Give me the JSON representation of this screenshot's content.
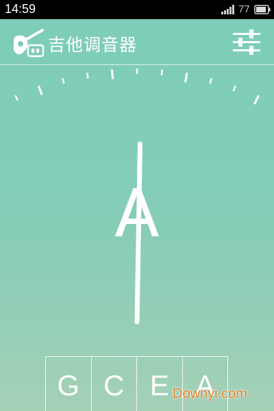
{
  "status_bar": {
    "time": "14:59",
    "battery_level": "77",
    "signal_icon": "signal-bars-icon",
    "battery_icon": "battery-icon"
  },
  "app_bar": {
    "title": "吉他调音器",
    "app_icon": "guitar-icon",
    "settings_icon": "sliders-icon"
  },
  "tuner": {
    "current_note": "A"
  },
  "strings": [
    {
      "label": "G"
    },
    {
      "label": "C"
    },
    {
      "label": "E"
    },
    {
      "label": "A"
    }
  ],
  "watermark": "Downyi.com",
  "colors": {
    "background_top": "#7ccdb9",
    "background_bottom": "#a4d0b6",
    "foreground": "#ffffff",
    "watermark": "#e07f2a"
  }
}
